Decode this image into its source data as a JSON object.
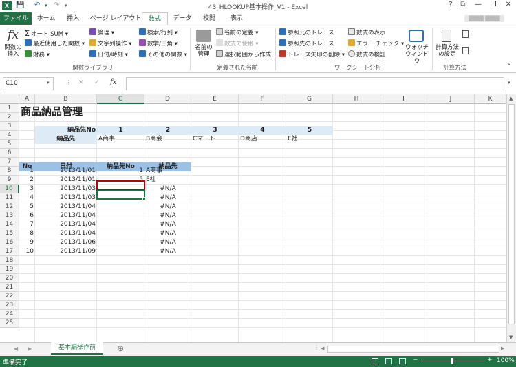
{
  "window": {
    "title": "43_HLOOKUP基本操作_V1 - Excel",
    "user": "████ ████"
  },
  "quick_access": {
    "save_icon": "save-icon",
    "undo_icon": "undo-icon",
    "redo_icon": "redo-icon"
  },
  "window_controls": {
    "help": "?",
    "restore_ribbon": "⧉",
    "minimize": "—",
    "maximize": "❐",
    "close": "✕"
  },
  "tabs": [
    {
      "label": "ファイル"
    },
    {
      "label": "ホーム"
    },
    {
      "label": "挿入"
    },
    {
      "label": "ページ レイアウト"
    },
    {
      "label": "数式"
    },
    {
      "label": "データ"
    },
    {
      "label": "校閲"
    },
    {
      "label": "表示"
    }
  ],
  "ribbon": {
    "insert_function": "関数の\n挿入",
    "autosum": "オート SUM",
    "recent": "最近使用した関数",
    "financial": "財務",
    "logical": "論理",
    "text": "文字列操作",
    "datetime": "日付/時刻",
    "lookup": "検索/行列",
    "math": "数学/三角",
    "other": "その他の関数",
    "group1": "関数ライブラリ",
    "name_manager": "名前の\n管理",
    "define_name": "名前の定義",
    "use_in_formula": "数式で使用",
    "create_from_sel": "選択範囲から作成",
    "group2": "定義された名前",
    "trace_prec": "参照元のトレース",
    "trace_dep": "参照先のトレース",
    "remove_arrows": "トレース矢印の削除",
    "show_formulas": "数式の表示",
    "error_check": "エラー チェック",
    "evaluate": "数式の検証",
    "watch": "ウォッチ\nウィンドウ",
    "group3": "ワークシート分析",
    "calc_options": "計算方法\nの設定",
    "group4": "計算方法"
  },
  "formula_bar": {
    "name_box": "C10",
    "cancel": "✕",
    "enter": "✓",
    "fx": "fx",
    "formula": ""
  },
  "columns": [
    "A",
    "B",
    "C",
    "D",
    "E",
    "F",
    "G",
    "H",
    "I",
    "J",
    "K",
    "L"
  ],
  "rows": [
    "1",
    "2",
    "3",
    "4",
    "5",
    "6",
    "7",
    "8",
    "9",
    "10",
    "11",
    "12",
    "13",
    "14",
    "15",
    "16",
    "17",
    "18",
    "19",
    "20",
    "21",
    "22",
    "23",
    "24",
    "25"
  ],
  "sheet": {
    "title": "商品納品管理",
    "header_row3": {
      "label": "納品先No",
      "values": [
        "1",
        "2",
        "3",
        "4",
        "5"
      ]
    },
    "header_row4": {
      "label": "納品先",
      "values": [
        "A商事",
        "B商会",
        "Cマート",
        "D商店",
        "E社"
      ]
    },
    "table_headers": [
      "No",
      "日付",
      "納品先No",
      "納品先"
    ],
    "table": [
      {
        "no": "1",
        "date": "2013/11/01",
        "cno": "1",
        "name": "A商事"
      },
      {
        "no": "2",
        "date": "2013/11/01",
        "cno": "5",
        "name": "E社"
      },
      {
        "no": "3",
        "date": "2013/11/03",
        "cno": "",
        "name": "#N/A"
      },
      {
        "no": "4",
        "date": "2013/11/03",
        "cno": "",
        "name": "#N/A"
      },
      {
        "no": "5",
        "date": "2013/11/04",
        "cno": "",
        "name": "#N/A"
      },
      {
        "no": "6",
        "date": "2013/11/04",
        "cno": "",
        "name": "#N/A"
      },
      {
        "no": "7",
        "date": "2013/11/04",
        "cno": "",
        "name": "#N/A"
      },
      {
        "no": "8",
        "date": "2013/11/04",
        "cno": "",
        "name": "#N/A"
      },
      {
        "no": "9",
        "date": "2013/11/06",
        "cno": "",
        "name": "#N/A"
      },
      {
        "no": "10",
        "date": "2013/11/09",
        "cno": "",
        "name": "#N/A"
      }
    ]
  },
  "sheet_tabs": {
    "active": "基本編操作前",
    "add": "⊕"
  },
  "status": {
    "ready": "準備完了",
    "zoom": "100%"
  },
  "colors": {
    "excel_green": "#217346",
    "header_blue": "#ddebf7",
    "table_header_blue": "#9bc2e6",
    "highlight_red": "#c00000"
  }
}
